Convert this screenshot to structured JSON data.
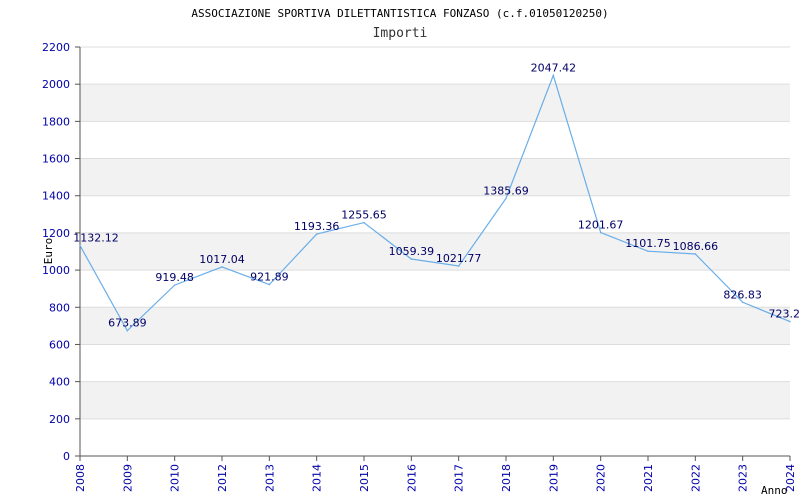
{
  "chart_data": {
    "type": "line",
    "title": "ASSOCIAZIONE SPORTIVA DILETTANTISTICA FONZASO (c.f.01050120250)",
    "subtitle": "Importi",
    "xlabel": "Anno",
    "ylabel": "Euro",
    "ylim": [
      0,
      2200
    ],
    "yticks": [
      0,
      200,
      400,
      600,
      800,
      1000,
      1200,
      1400,
      1600,
      1800,
      2000,
      2200
    ],
    "grid": "horizontal bands",
    "x": [
      "2008",
      "2009",
      "2010",
      "2011",
      "2012",
      "2013",
      "2014",
      "2015",
      "2016",
      "2017",
      "2018",
      "2019",
      "2020",
      "2021",
      "2022",
      "2023",
      "2024"
    ],
    "xtick_labels": [
      "2008",
      "2009",
      "2010",
      "2012",
      "2013",
      "2014",
      "2015",
      "2016",
      "2017",
      "2018",
      "2019",
      "2020",
      "2021",
      "2022",
      "2023",
      "2024"
    ],
    "values": [
      1132.12,
      673.89,
      919.48,
      1017.04,
      921.89,
      1193.36,
      1255.65,
      1059.39,
      1021.77,
      1385.69,
      2047.42,
      1201.67,
      1101.75,
      1086.66,
      826.83,
      723.2
    ],
    "data_labels": [
      "1132.12",
      "673.89",
      "919.48",
      "1017.04",
      "921.89",
      "1193.36",
      "1255.65",
      "1059.39",
      "1021.77",
      "1385.69",
      "2047.42",
      "1201.67",
      "1101.75",
      "1086.66",
      "826.83",
      "723.2"
    ],
    "colors": {
      "line": "#6aaee8",
      "band": "#f2f2f2",
      "grid": "#dddddd",
      "axis": "#555555",
      "tick_text": "#0000aa",
      "label_text": "#000066"
    }
  }
}
